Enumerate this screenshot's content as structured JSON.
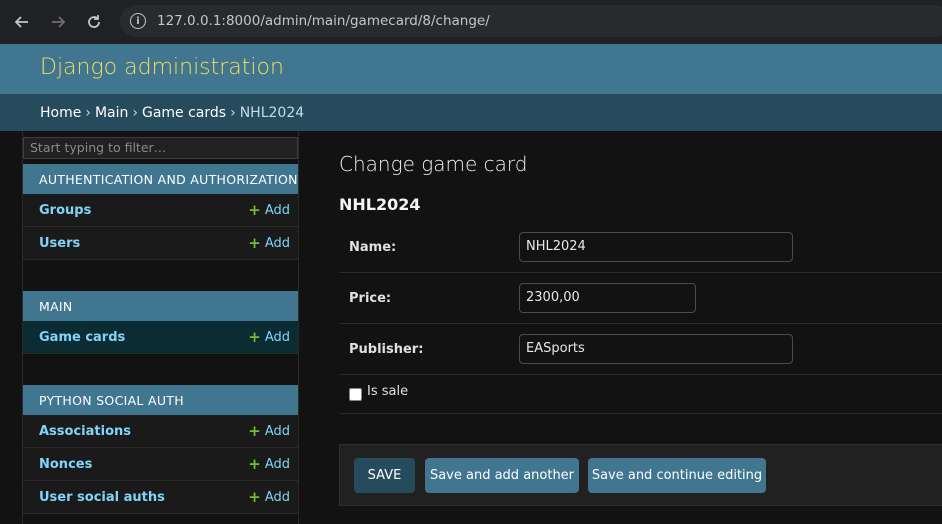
{
  "browser": {
    "url": "127.0.0.1:8000/admin/main/gamecard/8/change/",
    "back_icon": "arrow-left",
    "forward_icon": "arrow-right",
    "reload_icon": "reload"
  },
  "header": {
    "branding": "Django administration"
  },
  "breadcrumbs": {
    "items": [
      "Home",
      "Main",
      "Game cards",
      "NHL2024"
    ],
    "separator": "›"
  },
  "sidebar": {
    "filter_placeholder": "Start typing to filter…",
    "add_label": "Add",
    "modules": [
      {
        "caption": "AUTHENTICATION AND AUTHORIZATION",
        "models": [
          "Groups",
          "Users"
        ]
      },
      {
        "caption": "MAIN",
        "models": [
          "Game cards"
        ]
      },
      {
        "caption": "PYTHON SOCIAL AUTH",
        "models": [
          "Associations",
          "Nonces",
          "User social auths"
        ]
      }
    ]
  },
  "content": {
    "title": "Change game card",
    "object_title": "NHL2024",
    "fields": {
      "name_label": "Name:",
      "name_value": "NHL2024",
      "price_label": "Price:",
      "price_value": "2300,00",
      "publisher_label": "Publisher:",
      "publisher_value": "EASports",
      "is_sale_label": "Is sale",
      "is_sale_checked": false
    },
    "buttons": {
      "save": "SAVE",
      "save_add_another": "Save and add another",
      "save_continue": "Save and continue editing"
    }
  },
  "colors": {
    "header": "#417690",
    "branding": "#f5dd5d",
    "breadcrumbs": "#264b5d",
    "link": "#81d4fa",
    "add_plus": "#70bf2b",
    "active_row": "#0c2c34"
  }
}
